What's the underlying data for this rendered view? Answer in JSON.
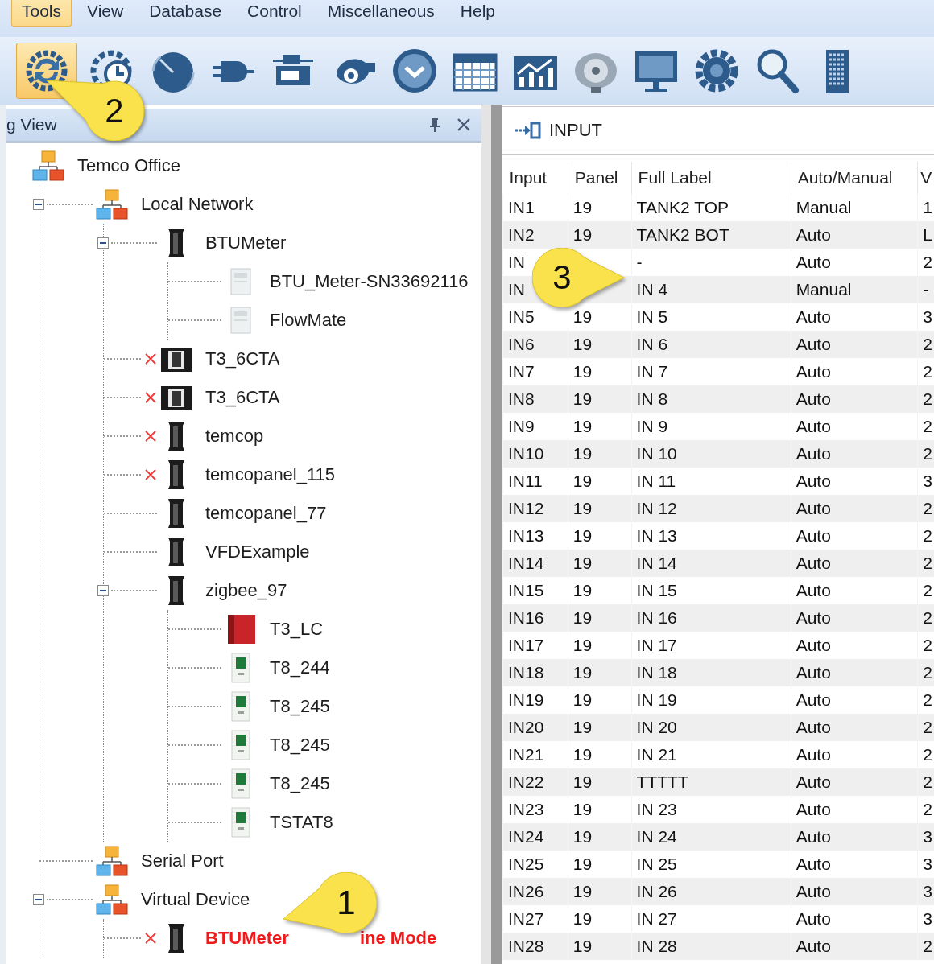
{
  "menu": [
    {
      "label": "Tools",
      "selected": true
    },
    {
      "label": "View",
      "selected": false
    },
    {
      "label": "Database",
      "selected": false
    },
    {
      "label": "Control",
      "selected": false
    },
    {
      "label": "Miscellaneous",
      "selected": false
    },
    {
      "label": "Help",
      "selected": false
    }
  ],
  "toolbar": [
    {
      "kind": "sync",
      "selected": true
    },
    {
      "kind": "clock_gear",
      "selected": false
    },
    {
      "kind": "dial",
      "selected": false
    },
    {
      "kind": "plug",
      "selected": false
    },
    {
      "kind": "program",
      "selected": false
    },
    {
      "kind": "blower",
      "selected": false
    },
    {
      "kind": "chevron",
      "selected": false
    },
    {
      "kind": "calendar",
      "selected": false
    },
    {
      "kind": "chart",
      "selected": false
    },
    {
      "kind": "speaker",
      "selected": false
    },
    {
      "kind": "monitor",
      "selected": false
    },
    {
      "kind": "gear",
      "selected": false
    },
    {
      "kind": "search",
      "selected": false
    },
    {
      "kind": "building",
      "selected": false
    }
  ],
  "tree_panel": {
    "title": "g View"
  },
  "tree": [
    {
      "label": "Temco Office",
      "kind": "network",
      "offline": false,
      "alert": false,
      "children": [
        {
          "label": "Local Network",
          "kind": "network",
          "expanded": true,
          "offline": false,
          "alert": false,
          "children": [
            {
              "label": "BTUMeter",
              "kind": "device",
              "expanded": true,
              "offline": false,
              "alert": false,
              "children": [
                {
                  "label": "BTU_Meter-SN33692116",
                  "kind": "sensor",
                  "offline": false,
                  "alert": false
                },
                {
                  "label": "FlowMate",
                  "kind": "sensor",
                  "offline": false,
                  "alert": false
                }
              ]
            },
            {
              "label": "T3_6CTA",
              "kind": "controller",
              "offline": true,
              "alert": false
            },
            {
              "label": "T3_6CTA",
              "kind": "controller",
              "offline": true,
              "alert": false
            },
            {
              "label": "temcop",
              "kind": "device",
              "offline": true,
              "alert": false
            },
            {
              "label": "temcopanel_115",
              "kind": "device",
              "offline": true,
              "alert": false
            },
            {
              "label": "temcopanel_77",
              "kind": "device",
              "offline": false,
              "alert": false
            },
            {
              "label": "VFDExample",
              "kind": "device",
              "offline": false,
              "alert": false
            },
            {
              "label": "zigbee_97",
              "kind": "device",
              "expanded": true,
              "offline": false,
              "alert": false,
              "children": [
                {
                  "label": "T3_LC",
                  "kind": "red_module",
                  "offline": false,
                  "alert": false
                },
                {
                  "label": "T8_244",
                  "kind": "thermostat",
                  "offline": false,
                  "alert": false
                },
                {
                  "label": "T8_245",
                  "kind": "thermostat",
                  "offline": false,
                  "alert": false
                },
                {
                  "label": "T8_245",
                  "kind": "thermostat",
                  "offline": false,
                  "alert": false
                },
                {
                  "label": "T8_245",
                  "kind": "thermostat",
                  "offline": false,
                  "alert": false
                },
                {
                  "label": "TSTAT8",
                  "kind": "thermostat",
                  "offline": false,
                  "alert": false
                }
              ]
            }
          ]
        },
        {
          "label": "Serial Port",
          "kind": "network",
          "offline": false,
          "alert": false
        },
        {
          "label": "Virtual Device",
          "kind": "network",
          "expanded": true,
          "offline": false,
          "alert": false,
          "children": [
            {
              "label": "BTUMeter",
              "label_tail": "ine Mode",
              "kind": "device",
              "offline": true,
              "alert": true
            }
          ]
        }
      ]
    }
  ],
  "input_tab": {
    "title": "INPUT"
  },
  "table": {
    "columns": [
      "Input",
      "Panel",
      "Full Label",
      "Auto/Manual",
      "V"
    ],
    "rows": [
      [
        "IN1",
        "19",
        "TANK2 TOP",
        "Manual",
        "1"
      ],
      [
        "IN2",
        "19",
        "TANK2 BOT",
        "Auto",
        "L"
      ],
      [
        "IN",
        "",
        "-",
        "Auto",
        "2"
      ],
      [
        "IN",
        "",
        "IN 4",
        "Manual",
        "-"
      ],
      [
        "IN5",
        "19",
        "IN 5",
        "Auto",
        "3"
      ],
      [
        "IN6",
        "19",
        "IN 6",
        "Auto",
        "2"
      ],
      [
        "IN7",
        "19",
        "IN 7",
        "Auto",
        "2"
      ],
      [
        "IN8",
        "19",
        "IN 8",
        "Auto",
        "2"
      ],
      [
        "IN9",
        "19",
        "IN 9",
        "Auto",
        "2"
      ],
      [
        "IN10",
        "19",
        "IN 10",
        "Auto",
        "2"
      ],
      [
        "IN11",
        "19",
        "IN 11",
        "Auto",
        "3"
      ],
      [
        "IN12",
        "19",
        "IN 12",
        "Auto",
        "2"
      ],
      [
        "IN13",
        "19",
        "IN 13",
        "Auto",
        "2"
      ],
      [
        "IN14",
        "19",
        "IN 14",
        "Auto",
        "2"
      ],
      [
        "IN15",
        "19",
        "IN 15",
        "Auto",
        "2"
      ],
      [
        "IN16",
        "19",
        "IN 16",
        "Auto",
        "2"
      ],
      [
        "IN17",
        "19",
        "IN 17",
        "Auto",
        "2"
      ],
      [
        "IN18",
        "19",
        "IN 18",
        "Auto",
        "2"
      ],
      [
        "IN19",
        "19",
        "IN 19",
        "Auto",
        "2"
      ],
      [
        "IN20",
        "19",
        "IN 20",
        "Auto",
        "2"
      ],
      [
        "IN21",
        "19",
        "IN 21",
        "Auto",
        "2"
      ],
      [
        "IN22",
        "19",
        "TTTTT",
        "Auto",
        "2"
      ],
      [
        "IN23",
        "19",
        "IN 23",
        "Auto",
        "2"
      ],
      [
        "IN24",
        "19",
        "IN 24",
        "Auto",
        "3"
      ],
      [
        "IN25",
        "19",
        "IN 25",
        "Auto",
        "3"
      ],
      [
        "IN26",
        "19",
        "IN 26",
        "Auto",
        "3"
      ],
      [
        "IN27",
        "19",
        "IN 27",
        "Auto",
        "3"
      ],
      [
        "IN28",
        "19",
        "IN 28",
        "Auto",
        "2"
      ]
    ]
  },
  "callouts": [
    {
      "number": "2"
    },
    {
      "number": "3"
    },
    {
      "number": "1"
    }
  ]
}
